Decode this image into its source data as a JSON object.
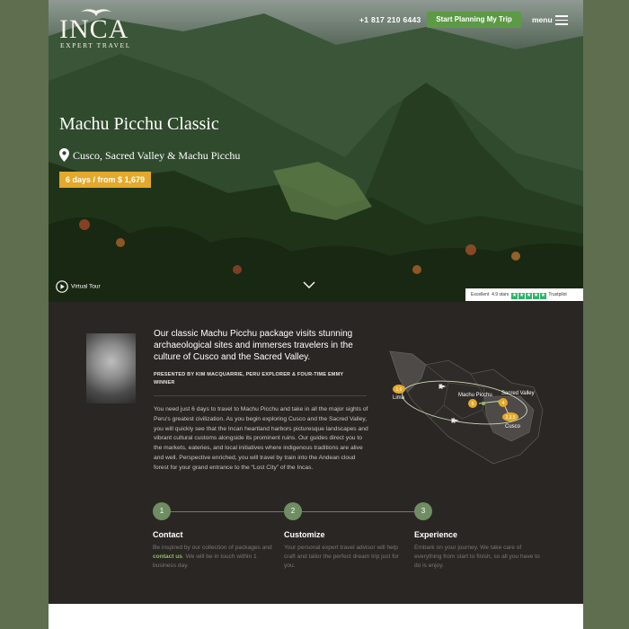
{
  "logo": {
    "word": "INCA",
    "sub": "EXPERT TRAVEL"
  },
  "header": {
    "phone": "+1 817 210 6443",
    "cta_label": "Start Planning My Trip",
    "menu_label": "menu"
  },
  "hero": {
    "title": "Machu Picchu Classic",
    "location": "Cusco, Sacred Valley & Machu Picchu",
    "badge": "6 days / from $ 1,679",
    "virtual_tour": "Virtual Tour"
  },
  "trustpilot": {
    "label": "Excellent",
    "score": "4.9 stars",
    "brand": "Trustpilot"
  },
  "intro": {
    "lead": "Our classic Machu Picchu package visits stunning archaeological sites and immerses travelers in the culture of Cusco and the Sacred Valley.",
    "presented_by": "PRESENTED BY KIM MACQUARRIE, PERU EXPLORER & FOUR-TIME EMMY WINNER",
    "body": "You need just 6 days to travel to Machu Picchu and take in all the major sights of Peru's greatest civilization. As you begin exploring Cusco and the Sacred Valley, you will quickly see that the Incan heartland harbors picturesque landscapes and vibrant cultural customs alongside its prominent ruins. Our guides direct you to the markets, eateries, and local initiatives where indigenous traditions are alive and well. Perspective enriched, you will travel by train into the Andean cloud forest for your grand entrance to the “Lost City” of the Incas."
  },
  "map": {
    "labels": {
      "lima": "Lima",
      "machu_picchu": "Machu Picchu",
      "sacred_valley": "Sacred Valley",
      "cusco": "Cusco"
    },
    "badges": {
      "lima": "1,6",
      "machu_picchu": "5",
      "sacred_valley": "4",
      "cusco": "2,3,5"
    },
    "colors": {
      "badge": "#e4a92a",
      "route": "#c9d9b8",
      "land": "#4e4a48",
      "highlight": "#6b6664"
    }
  },
  "steps": [
    {
      "num": "1",
      "title": "Contact",
      "pre": "Be inspired by our collection of packages and ",
      "link": "contact us",
      "post": ". We will be in touch within 1 business day."
    },
    {
      "num": "2",
      "title": "Customize",
      "text": "Your personal expert travel advisor will help craft and tailor the perfect dream trip just for you."
    },
    {
      "num": "3",
      "title": "Experience",
      "text": "Embark on your journey. We take care of everything from start to finish, so all you have to do is enjoy."
    }
  ],
  "colors": {
    "accent": "#5c9a46",
    "badge": "#e4a92a",
    "dark_bg": "#2a2624",
    "step_circle": "#6f8d62",
    "link": "#8fbd5e"
  }
}
